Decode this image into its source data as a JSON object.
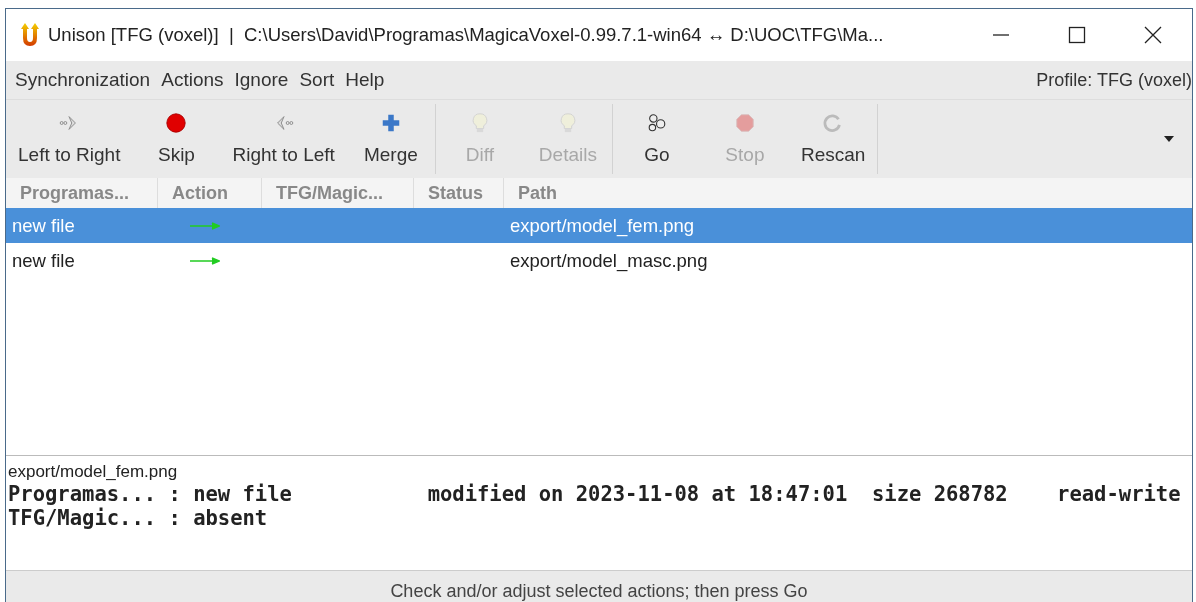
{
  "window": {
    "title": "Unison [TFG (voxel)]  |  C:\\Users\\David\\Programas\\MagicaVoxel-0.99.7.1-win64 ↔ D:\\UOC\\TFG\\Ma..."
  },
  "menu": [
    "Synchronization",
    "Actions",
    "Ignore",
    "Sort",
    "Help"
  ],
  "profile": "Profile: TFG (voxel)",
  "toolbar": {
    "groups": [
      [
        {
          "label": "Left to Right",
          "disabled": false
        },
        {
          "label": "Skip",
          "disabled": false
        },
        {
          "label": "Right to Left",
          "disabled": false
        },
        {
          "label": "Merge",
          "disabled": false
        }
      ],
      [
        {
          "label": "Diff",
          "disabled": true
        },
        {
          "label": "Details",
          "disabled": true
        }
      ],
      [
        {
          "label": "Go",
          "disabled": false
        },
        {
          "label": "Stop",
          "disabled": true
        },
        {
          "label": "Rescan",
          "disabled": false
        }
      ]
    ]
  },
  "table": {
    "columns": [
      "Programas...",
      "Action",
      "TFG/Magic...",
      "Status",
      "Path"
    ],
    "rows": [
      {
        "left": "new file",
        "left_to_right": true,
        "path": "export/model_fem.png",
        "selected": true
      },
      {
        "left": "new file",
        "left_to_right": true,
        "path": "export/model_masc.png",
        "selected": false
      }
    ]
  },
  "details": {
    "path": "export/model_fem.png",
    "lines": [
      "Programas... : new file           modified on 2023-11-08 at 18:47:01  size 268782    read-write",
      "TFG/Magic... : absent"
    ]
  },
  "status_bar": "Check and/or adjust selected actions; then press Go"
}
